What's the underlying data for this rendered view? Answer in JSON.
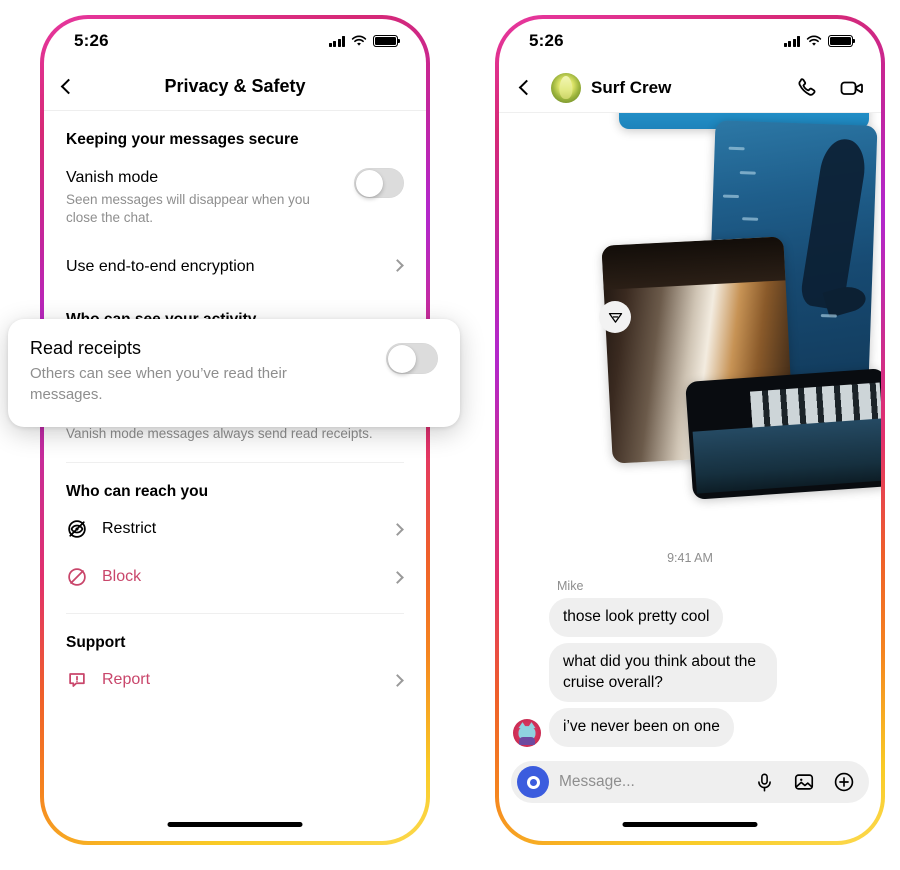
{
  "phones": {
    "left": {
      "status": {
        "time": "5:26",
        "signal_icon": "cellular-signal-icon",
        "wifi_icon": "wifi-icon",
        "battery_icon": "battery-icon"
      },
      "nav": {
        "back_icon": "chevron-left-icon",
        "title": "Privacy & Safety"
      },
      "sections": [
        {
          "heading": "Keeping your messages secure",
          "rows": [
            {
              "type": "toggle",
              "title": "Vanish mode",
              "subtitle": "Seen messages will disappear when you close the chat.",
              "value": "off"
            },
            {
              "type": "link",
              "title": "Use end-to-end encryption",
              "chevron_icon": "chevron-right-icon"
            }
          ]
        },
        {
          "heading": "Who can see your activity",
          "note": "Vanish mode messages always send read receipts."
        },
        {
          "heading": "Who can reach you",
          "items": [
            {
              "label": "Restrict",
              "icon": "restrict-icon",
              "color": "#000000",
              "chevron_icon": "chevron-right-icon"
            },
            {
              "label": "Block",
              "icon": "block-icon",
              "color": "#c9466b",
              "chevron_icon": "chevron-right-icon"
            }
          ]
        },
        {
          "heading": "Support",
          "items": [
            {
              "label": "Report",
              "icon": "report-icon",
              "color": "#c9466b",
              "chevron_icon": "chevron-right-icon"
            }
          ]
        }
      ],
      "overlay": {
        "title": "Read receipts",
        "subtitle": "Others can see when you’ve read their messages.",
        "toggle_value": "off"
      },
      "home_indicator": "home-indicator"
    },
    "right": {
      "status": {
        "time": "5:26",
        "signal_icon": "cellular-signal-icon",
        "wifi_icon": "wifi-icon",
        "battery_icon": "battery-icon"
      },
      "nav": {
        "back_icon": "chevron-left-icon",
        "avatar": "group-avatar",
        "title": "Surf Crew",
        "call_icon": "phone-call-icon",
        "video_icon": "video-camera-icon"
      },
      "collage": {
        "share_icon": "share-paper-plane-icon",
        "photos": [
          "photo-ocean-top",
          "photo-freediver",
          "photo-ship-room",
          "photo-indoor-pool"
        ]
      },
      "timestamp": "9:41 AM",
      "messages": [
        {
          "sender": "Mike",
          "text": "those look pretty cool",
          "avatar": null
        },
        {
          "sender": null,
          "text": "what did you think about the cruise overall?",
          "avatar": null
        },
        {
          "sender": null,
          "text": "i’ve never been on one",
          "avatar": "cat-avatar"
        }
      ],
      "composer": {
        "camera_icon": "camera-icon",
        "placeholder": "Message...",
        "mic_icon": "microphone-icon",
        "gallery_icon": "photo-gallery-icon",
        "plus_icon": "plus-circle-icon"
      },
      "home_indicator": "home-indicator"
    }
  },
  "colors": {
    "frame_gradient_start": "#e7379f",
    "frame_gradient_mid": "#b327c9",
    "frame_gradient_end": "#fcd94f",
    "accent_red": "#c9466b",
    "bubble_bg": "#efefef",
    "muted_text": "#8e8e8e"
  }
}
